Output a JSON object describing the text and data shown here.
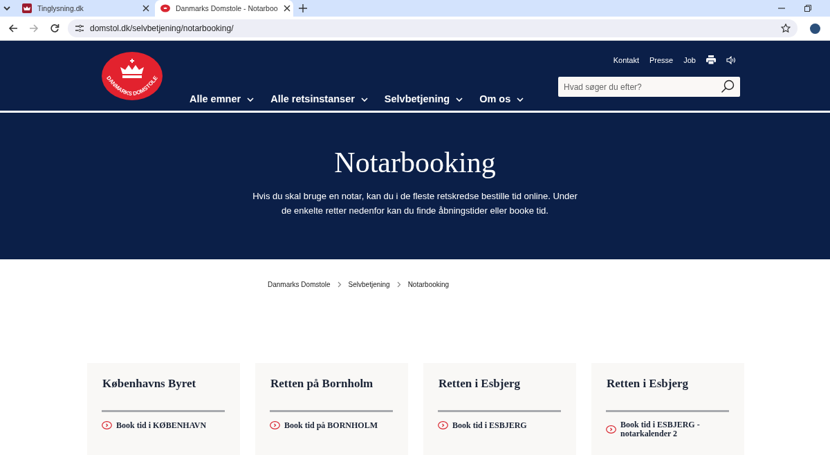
{
  "browser": {
    "tabs": [
      {
        "title": "Tinglysning.dk",
        "selected": false
      },
      {
        "title": "Danmarks Domstole - Notarboo",
        "selected": true
      }
    ],
    "url": "domstol.dk/selvbetjening/notarbooking/"
  },
  "header": {
    "logo_text": "DANMARKS DOMSTOLE",
    "utility_links": [
      "Kontakt",
      "Presse",
      "Job"
    ],
    "nav": [
      "Alle emner",
      "Alle retsinstanser",
      "Selvbetjening",
      "Om os"
    ],
    "search": {
      "placeholder": "Hvad søger du efter?"
    }
  },
  "hero": {
    "title": "Notarbooking",
    "text": "Hvis du skal bruge en notar, kan du i de fleste retskredse bestille tid online. Under de enkelte retter nedenfor kan du finde åbningstider eller booke tid."
  },
  "breadcrumb": [
    "Danmarks Domstole",
    "Selvbetjening",
    "Notarbooking"
  ],
  "cards": [
    {
      "title": "Københavns Byret",
      "link": "Book tid i KØBENHAVN"
    },
    {
      "title": "Retten på Bornholm",
      "link": "Book tid på BORNHOLM"
    },
    {
      "title": "Retten i Esbjerg",
      "link": "Book tid i ESBJERG"
    },
    {
      "title": "Retten i Esbjerg",
      "link": "Book tid i ESBJERG - notarkalender 2"
    }
  ]
}
